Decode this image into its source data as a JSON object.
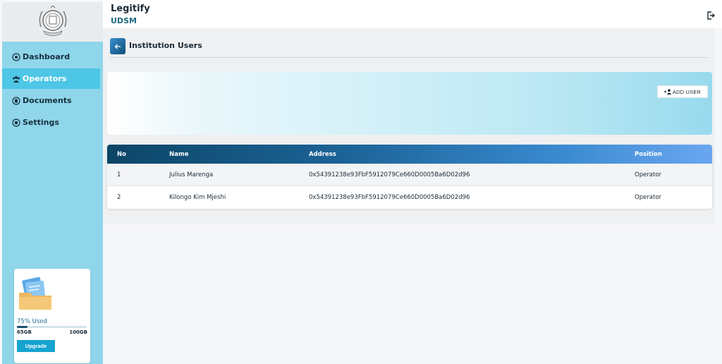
{
  "sidebar": {
    "items": [
      {
        "label": "Dashboard",
        "icon": "dashboard-icon"
      },
      {
        "label": "Operators",
        "icon": "users-icon"
      },
      {
        "label": "Documents",
        "icon": "documents-icon"
      },
      {
        "label": "Settings",
        "icon": "settings-icon"
      }
    ],
    "active_item": "Operators",
    "storage": {
      "used_text": "75% Used",
      "used_fraction": 0.75,
      "min_label": "65GB",
      "max_label": "100GB",
      "upgrade_label": "Upgrade"
    }
  },
  "header": {
    "app_title": "Legitify",
    "institution": "UDSM"
  },
  "main": {
    "page_title": "Institution Users",
    "add_user_label": "ADD USER",
    "table": {
      "columns": [
        "No",
        "Name",
        "Address",
        "Position"
      ],
      "rows": [
        [
          "1",
          "Julius Marenga",
          "0x54391238e93FbF5912079Ce660D0005Ba6D02d96",
          "Operator"
        ],
        [
          "2",
          "Kilongo Kim Mjeshi",
          "0x54391238e93FbF5912079Ce660D0005Ba6D02d96",
          "Operator"
        ]
      ]
    }
  },
  "colors": {
    "sidebar_bg": "#8fd6ea",
    "active_item": "#4ec6e6",
    "accent": "#16a3cf",
    "table_header_start": "#0c4567",
    "table_header_end": "#6aa6f0"
  }
}
